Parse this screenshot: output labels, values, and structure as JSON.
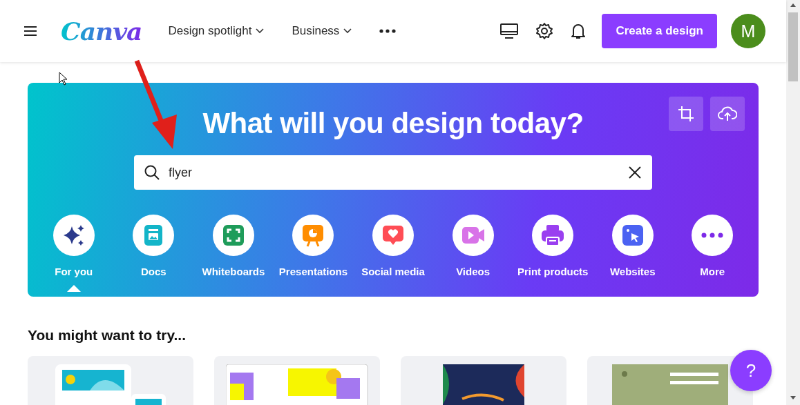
{
  "header": {
    "logo": "Canva",
    "nav": [
      {
        "label": "Design spotlight"
      },
      {
        "label": "Business"
      }
    ],
    "create_button": "Create a design",
    "avatar": "M"
  },
  "hero": {
    "title": "What will you design today?",
    "search": {
      "value": "flyer"
    },
    "categories": [
      {
        "label": "For you",
        "kind": "sparkle",
        "selected": true
      },
      {
        "label": "Docs",
        "kind": "doc",
        "selected": false
      },
      {
        "label": "Whiteboards",
        "kind": "whiteboard",
        "selected": false
      },
      {
        "label": "Presentations",
        "kind": "presentation",
        "selected": false
      },
      {
        "label": "Social media",
        "kind": "social",
        "selected": false
      },
      {
        "label": "Videos",
        "kind": "video",
        "selected": false
      },
      {
        "label": "Print products",
        "kind": "print",
        "selected": false
      },
      {
        "label": "Websites",
        "kind": "website",
        "selected": false
      },
      {
        "label": "More",
        "kind": "more",
        "selected": false
      }
    ]
  },
  "suggestions": {
    "heading": "You might want to try..."
  },
  "help_button": "?"
}
